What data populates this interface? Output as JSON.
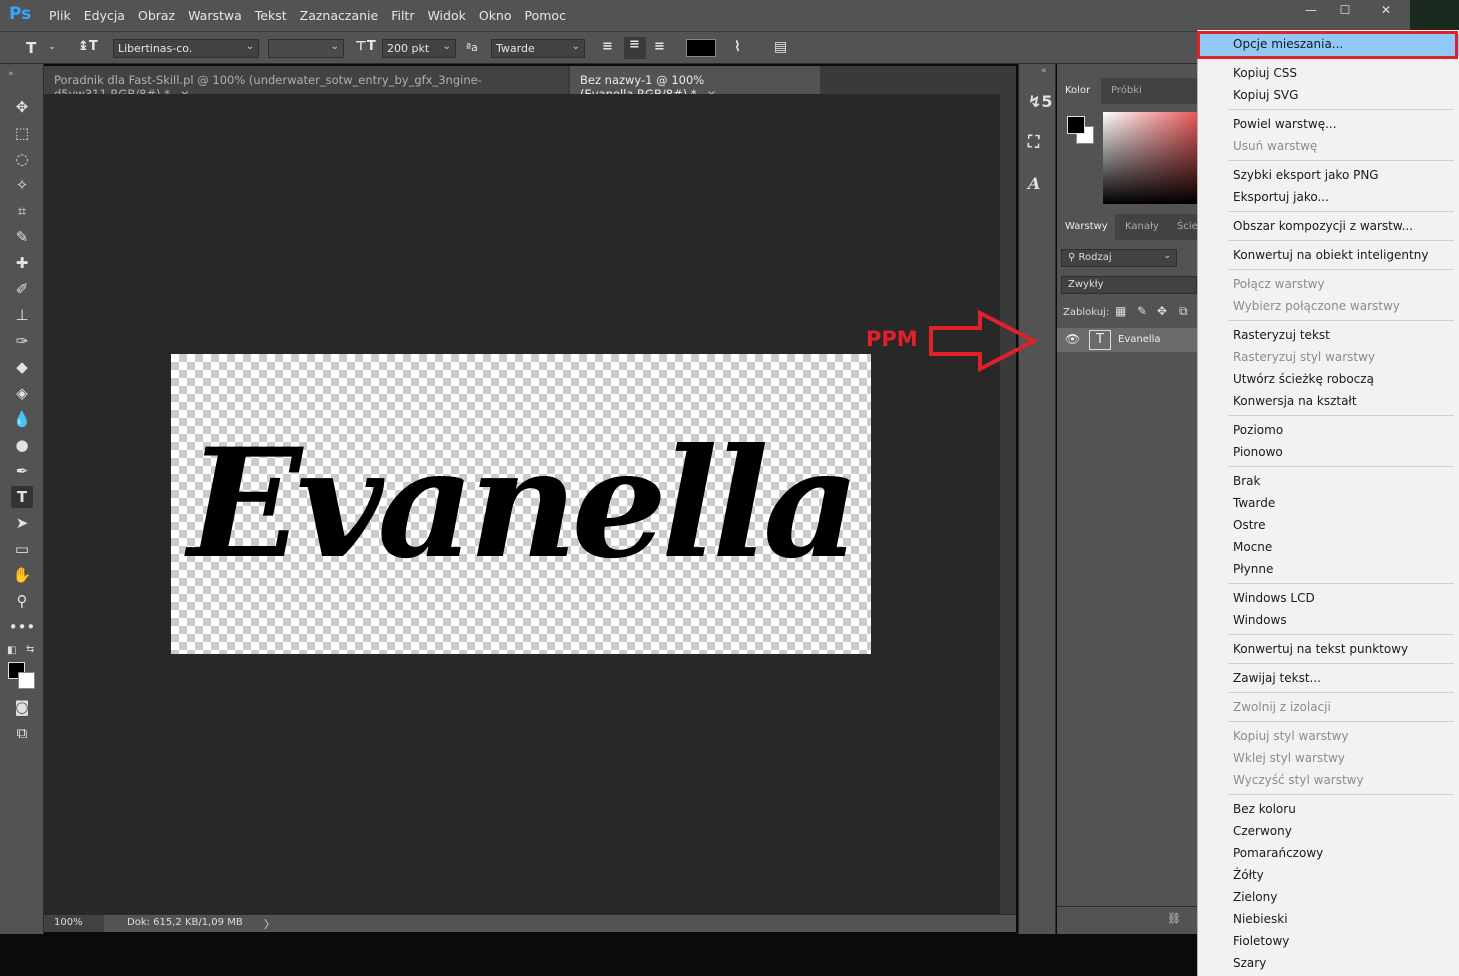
{
  "app": {
    "logo": "Ps"
  },
  "menubar": [
    "Plik",
    "Edycja",
    "Obraz",
    "Warstwa",
    "Tekst",
    "Zaznaczanie",
    "Filtr",
    "Widok",
    "Okno",
    "Pomoc"
  ],
  "window_controls": {
    "minimize": "—",
    "maximize": "☐",
    "close": "✕"
  },
  "options": {
    "tool_glyph": "T",
    "font_family": "Libertinas-co.",
    "font_size": "200 pkt",
    "aa_label": "ªa",
    "antialias": "Twarde",
    "text_color": "#000000"
  },
  "tabs": [
    {
      "label": "Poradnik dla Fast-Skill.pl @ 100% (underwater_sotw_entry_by_gfx_3ngine-d5yw311,RGB/8#) *",
      "close": "×",
      "active": false
    },
    {
      "label": "Bez nazwy-1 @ 100% (Evanella,RGB/8#) *",
      "close": "×",
      "active": true
    }
  ],
  "canvas": {
    "text": "Evanella"
  },
  "status": {
    "zoom": "100%",
    "doc": "Dok: 615,2 KB/1,09 MB",
    "chev": "〉"
  },
  "color_panel": {
    "tabs": [
      "Kolor",
      "Próbki"
    ],
    "fg": "#000000",
    "bg": "#ffffff"
  },
  "layers_panel": {
    "tabs": [
      "Warstwy",
      "Kanały",
      "Ście"
    ],
    "filter": "Rodzaj",
    "blend_mode": "Zwykły",
    "lock_label": "Zablokuj:",
    "layers": [
      {
        "name": "Evanella",
        "thumb": "T"
      }
    ]
  },
  "annotation": {
    "label": "PPM",
    "color": "#e0202a"
  },
  "context_menu": {
    "groups": [
      [
        {
          "label": "Opcje mieszania...",
          "disabled": false,
          "highlight": true
        }
      ],
      [
        {
          "label": "Kopiuj CSS",
          "disabled": false
        },
        {
          "label": "Kopiuj SVG",
          "disabled": false
        }
      ],
      [
        {
          "label": "Powiel warstwę...",
          "disabled": false
        },
        {
          "label": "Usuń warstwę",
          "disabled": true
        }
      ],
      [
        {
          "label": "Szybki eksport jako PNG",
          "disabled": false
        },
        {
          "label": "Eksportuj jako...",
          "disabled": false
        }
      ],
      [
        {
          "label": "Obszar kompozycji z warstw...",
          "disabled": false
        }
      ],
      [
        {
          "label": "Konwertuj na obiekt inteligentny",
          "disabled": false
        }
      ],
      [
        {
          "label": "Połącz warstwy",
          "disabled": true
        },
        {
          "label": "Wybierz połączone warstwy",
          "disabled": true
        }
      ],
      [
        {
          "label": "Rasteryzuj tekst",
          "disabled": false
        },
        {
          "label": "Rasteryzuj styl warstwy",
          "disabled": true
        },
        {
          "label": "Utwórz ścieżkę roboczą",
          "disabled": false
        },
        {
          "label": "Konwersja na kształt",
          "disabled": false
        }
      ],
      [
        {
          "label": "Poziomo",
          "disabled": false
        },
        {
          "label": "Pionowo",
          "disabled": false
        }
      ],
      [
        {
          "label": "Brak",
          "disabled": false
        },
        {
          "label": "Twarde",
          "disabled": false
        },
        {
          "label": "Ostre",
          "disabled": false
        },
        {
          "label": "Mocne",
          "disabled": false
        },
        {
          "label": "Płynne",
          "disabled": false
        }
      ],
      [
        {
          "label": "Windows LCD",
          "disabled": false
        },
        {
          "label": "Windows",
          "disabled": false
        }
      ],
      [
        {
          "label": "Konwertuj na tekst punktowy",
          "disabled": false
        }
      ],
      [
        {
          "label": "Zawijaj tekst...",
          "disabled": false
        }
      ],
      [
        {
          "label": "Zwolnij z izolacji",
          "disabled": true
        }
      ],
      [
        {
          "label": "Kopiuj styl warstwy",
          "disabled": true
        },
        {
          "label": "Wklej styl warstwy",
          "disabled": true
        },
        {
          "label": "Wyczyść styl warstwy",
          "disabled": true
        }
      ],
      [
        {
          "label": "Bez koloru",
          "disabled": false
        },
        {
          "label": "Czerwony",
          "disabled": false
        },
        {
          "label": "Pomarańczowy",
          "disabled": false
        },
        {
          "label": "Żółty",
          "disabled": false
        },
        {
          "label": "Zielony",
          "disabled": false
        },
        {
          "label": "Niebieski",
          "disabled": false
        },
        {
          "label": "Fioletowy",
          "disabled": false
        },
        {
          "label": "Szary",
          "disabled": false
        }
      ]
    ]
  }
}
